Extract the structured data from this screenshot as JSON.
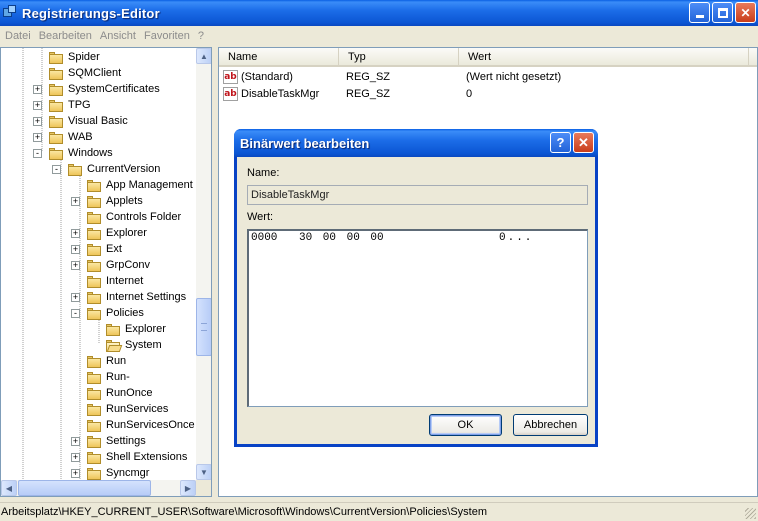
{
  "window": {
    "title": "Registrierungs-Editor",
    "icon": "regedit-icon"
  },
  "menu": [
    "Datei",
    "Bearbeiten",
    "Ansicht",
    "Favoriten",
    "?"
  ],
  "tree": {
    "items": [
      {
        "label": "Spider",
        "level": 2,
        "expander": ""
      },
      {
        "label": "SQMClient",
        "level": 2,
        "expander": ""
      },
      {
        "label": "SystemCertificates",
        "level": 2,
        "expander": "+"
      },
      {
        "label": "TPG",
        "level": 2,
        "expander": "+"
      },
      {
        "label": "Visual Basic",
        "level": 2,
        "expander": "+"
      },
      {
        "label": "WAB",
        "level": 2,
        "expander": "+"
      },
      {
        "label": "Windows",
        "level": 2,
        "expander": "-"
      },
      {
        "label": "CurrentVersion",
        "level": 3,
        "expander": "-"
      },
      {
        "label": "App Management",
        "level": 4,
        "expander": ""
      },
      {
        "label": "Applets",
        "level": 4,
        "expander": "+"
      },
      {
        "label": "Controls Folder",
        "level": 4,
        "expander": ""
      },
      {
        "label": "Explorer",
        "level": 4,
        "expander": "+"
      },
      {
        "label": "Ext",
        "level": 4,
        "expander": "+"
      },
      {
        "label": "GrpConv",
        "level": 4,
        "expander": "+"
      },
      {
        "label": "Internet",
        "level": 4,
        "expander": ""
      },
      {
        "label": "Internet Settings",
        "level": 4,
        "expander": "+"
      },
      {
        "label": "Policies",
        "level": 4,
        "expander": "-"
      },
      {
        "label": "Explorer",
        "level": 5,
        "expander": ""
      },
      {
        "label": "System",
        "level": 5,
        "expander": "",
        "open": true
      },
      {
        "label": "Run",
        "level": 4,
        "expander": ""
      },
      {
        "label": "Run-",
        "level": 4,
        "expander": ""
      },
      {
        "label": "RunOnce",
        "level": 4,
        "expander": ""
      },
      {
        "label": "RunServices",
        "level": 4,
        "expander": ""
      },
      {
        "label": "RunServicesOnce",
        "level": 4,
        "expander": ""
      },
      {
        "label": "Settings",
        "level": 4,
        "expander": "+"
      },
      {
        "label": "Shell Extensions",
        "level": 4,
        "expander": "+"
      },
      {
        "label": "Syncmgr",
        "level": 4,
        "expander": "+"
      }
    ]
  },
  "list": {
    "columns": [
      "Name",
      "Typ",
      "Wert"
    ],
    "rows": [
      {
        "name": "(Standard)",
        "type": "REG_SZ",
        "value": "(Wert nicht gesetzt)",
        "icon": "string-value-icon"
      },
      {
        "name": "DisableTaskMgr",
        "type": "REG_SZ",
        "value": "0",
        "icon": "string-value-icon"
      }
    ]
  },
  "status": {
    "path": "Arbeitsplatz\\HKEY_CURRENT_USER\\Software\\Microsoft\\Windows\\CurrentVersion\\Policies\\System"
  },
  "dialog": {
    "title": "Binärwert bearbeiten",
    "help_glyph": "?",
    "close_glyph": "✕",
    "name_label": "Name:",
    "name_value": "DisableTaskMgr",
    "value_label": "Wert:",
    "hex_offset": "0000",
    "hex_bytes": "30 00 00 00",
    "hex_ascii": "0...",
    "ok_label": "OK",
    "cancel_label": "Abbrechen"
  },
  "icon_glyph": "ab",
  "colors": {
    "title_blue": "#0a5fe3",
    "window_bg": "#ece9d8",
    "close_red": "#c93d1a"
  }
}
